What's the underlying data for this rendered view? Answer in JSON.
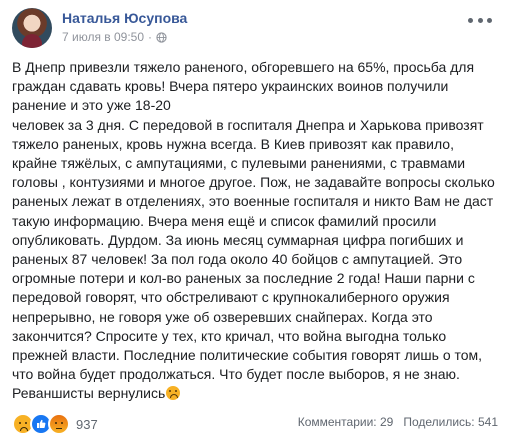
{
  "post": {
    "author": "Наталья Юсупова",
    "timestamp": "7 июля в 09:50",
    "privacy_icon": "globe-icon",
    "text_lines": [
      "В Днепр привезли тяжело раненого, обгоревшего на 65%, просьба для",
      "граждан сдавать кровь! Вчера пятеро украинских воинов получили",
      "ранение и это уже 18-20",
      "человек за 3 дня. С передовой в госпиталя Днепра и Харькова привозят",
      "тяжело раненых, кровь нужна всегда. В Киев привозят как правило,",
      "крайне тяжёлых, с ампутациями, с пулевыми ранениями, с травмами",
      "головы , контузиями и многое другое. Пож, не задавайте вопросы сколько",
      "раненых лежат в отделениях, это военные госпиталя и никто Вам не даст",
      "такую информацию. Вчера меня ещё и список фамилий просили",
      "опубликовать. Дурдом. За июнь месяц суммарная цифра погибших и",
      "раненых 87 человек! За пол года около 40 бойцов с ампутацией. Это",
      "огромные потери и кол-во раненых за последние 2 года! Наши парни с",
      "передовой говорят, что обстреливают с крупнокалиберного оружия",
      "непрерывно, не говоря уже об озверевших снайперах. Когда это",
      "закончится? Спросите у тех, кто кричал, что война выгодна только",
      "прежней власти. Последние политические события говорят лишь о том,",
      "что война будет продолжаться. Что будет после выборов, я не знаю.",
      "Реваншисты вернулись"
    ]
  },
  "footer": {
    "reaction_icons": [
      "sad-reaction-icon",
      "like-reaction-icon",
      "angry-reaction-icon"
    ],
    "reaction_count": "937",
    "comments": "Комментарии: 29",
    "shares": "Поделились: 541"
  },
  "colors": {
    "author_link": "#385898",
    "meta_text": "#90949c",
    "body_text": "#1c1e21",
    "like_blue": "#1877f2",
    "emoji_yellow": "#f7b125"
  }
}
